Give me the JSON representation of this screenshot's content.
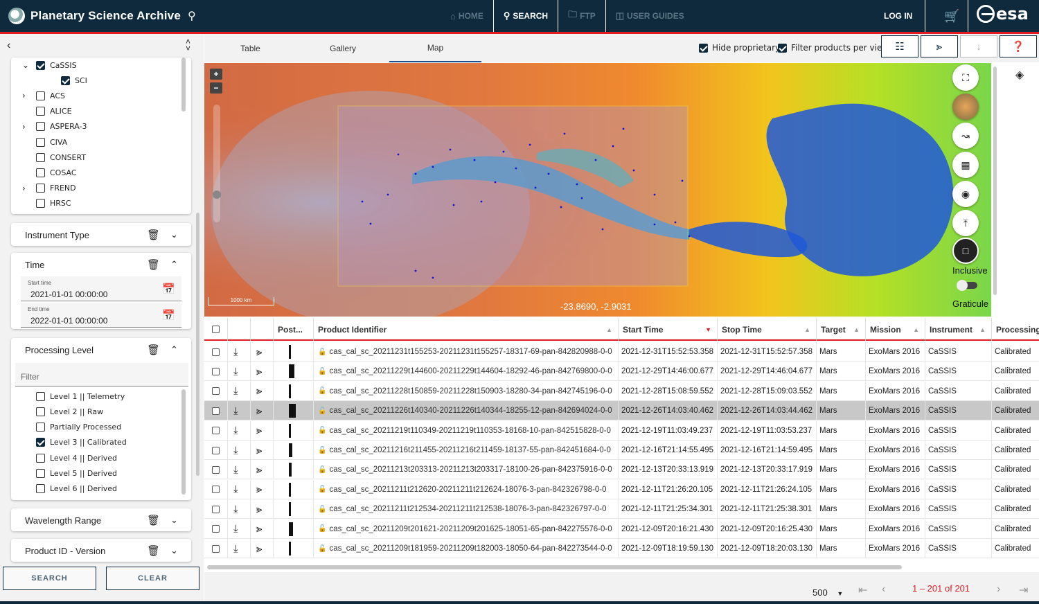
{
  "header": {
    "title": "Planetary Science Archive",
    "nav": [
      {
        "label": "HOME",
        "icon": "home-icon"
      },
      {
        "label": "SEARCH",
        "icon": "search-icon"
      },
      {
        "label": "FTP",
        "icon": "folder-icon"
      },
      {
        "label": "USER GUIDES",
        "icon": "book-icon"
      }
    ],
    "login": "LOG IN",
    "brand": "esa"
  },
  "sidebar": {
    "tree": [
      {
        "label": "CaSSIS",
        "checked": true,
        "expanded": true
      },
      {
        "label": "SCI",
        "checked": true,
        "child": true
      },
      {
        "label": "ACS",
        "checked": false,
        "expandable": true
      },
      {
        "label": "ALICE",
        "checked": false
      },
      {
        "label": "ASPERA-3",
        "checked": false,
        "expandable": true
      },
      {
        "label": "CIVA",
        "checked": false
      },
      {
        "label": "CONSERT",
        "checked": false
      },
      {
        "label": "COSAC",
        "checked": false
      },
      {
        "label": "FREND",
        "checked": false,
        "expandable": true
      },
      {
        "label": "HRSC",
        "checked": false
      }
    ],
    "instrument_type": "Instrument Type",
    "time": {
      "title": "Time",
      "start_label": "Start time",
      "start_value": "2021-01-01 00:00:00",
      "end_label": "End time",
      "end_value": "2022-01-01 00:00:00"
    },
    "processing": {
      "title": "Processing Level",
      "filter_placeholder": "Filter",
      "levels": [
        {
          "label": "Level 1 || Telemetry",
          "checked": false
        },
        {
          "label": "Level 2 || Raw",
          "checked": false
        },
        {
          "label": "Partially Processed",
          "checked": false
        },
        {
          "label": "Level 3 || Calibrated",
          "checked": true
        },
        {
          "label": "Level 4 || Derived",
          "checked": false
        },
        {
          "label": "Level 5 || Derived",
          "checked": false
        },
        {
          "label": "Level 6 || Derived",
          "checked": false
        }
      ]
    },
    "wavelength": "Wavelength Range",
    "product_id": "Product ID - Version",
    "search_button": "SEARCH",
    "clear_button": "CLEAR"
  },
  "tabs": [
    "Table",
    "Gallery",
    "Map"
  ],
  "options": {
    "hide_proprietary": "Hide proprietary",
    "filter_per_view": "Filter products per view"
  },
  "map": {
    "scale": "1000 km",
    "coords": "-23.8690, -2.9031",
    "inclusive_label": "Inclusive",
    "graticule_label": "Graticule"
  },
  "table": {
    "columns": [
      "Post...",
      "Product Identifier",
      "Start Time",
      "Stop Time",
      "Target",
      "Mission",
      "Instrument",
      "Processing"
    ],
    "rows": [
      {
        "id": "cas_cal_sc_20211231t155253-20211231t155257-18317-69-pan-842820988-0-0",
        "start": "2021-12-31T15:52:53.358",
        "stop": "2021-12-31T15:52:57.358",
        "target": "Mars",
        "mission": "ExoMars 2016",
        "instrument": "CaSSIS",
        "processing": "Calibrated"
      },
      {
        "id": "cas_cal_sc_20211229t144600-20211229t144604-18292-46-pan-842769800-0-0",
        "start": "2021-12-29T14:46:00.677",
        "stop": "2021-12-29T14:46:04.677",
        "target": "Mars",
        "mission": "ExoMars 2016",
        "instrument": "CaSSIS",
        "processing": "Calibrated"
      },
      {
        "id": "cas_cal_sc_20211228t150859-20211228t150903-18280-34-pan-842745196-0-0",
        "start": "2021-12-28T15:08:59.552",
        "stop": "2021-12-28T15:09:03.552",
        "target": "Mars",
        "mission": "ExoMars 2016",
        "instrument": "CaSSIS",
        "processing": "Calibrated"
      },
      {
        "id": "cas_cal_sc_20211226t140340-20211226t140344-18255-12-pan-842694024-0-0",
        "start": "2021-12-26T14:03:40.462",
        "stop": "2021-12-26T14:03:44.462",
        "target": "Mars",
        "mission": "ExoMars 2016",
        "instrument": "CaSSIS",
        "processing": "Calibrated"
      },
      {
        "id": "cas_cal_sc_20211219t110349-20211219t110353-18168-10-pan-842515828-0-0",
        "start": "2021-12-19T11:03:49.237",
        "stop": "2021-12-19T11:03:53.237",
        "target": "Mars",
        "mission": "ExoMars 2016",
        "instrument": "CaSSIS",
        "processing": "Calibrated"
      },
      {
        "id": "cas_cal_sc_20211216t211455-20211216t211459-18137-55-pan-842451684-0-0",
        "start": "2021-12-16T21:14:55.495",
        "stop": "2021-12-16T21:14:59.495",
        "target": "Mars",
        "mission": "ExoMars 2016",
        "instrument": "CaSSIS",
        "processing": "Calibrated"
      },
      {
        "id": "cas_cal_sc_20211213t203313-20211213t203317-18100-26-pan-842375916-0-0",
        "start": "2021-12-13T20:33:13.919",
        "stop": "2021-12-13T20:33:17.919",
        "target": "Mars",
        "mission": "ExoMars 2016",
        "instrument": "CaSSIS",
        "processing": "Calibrated"
      },
      {
        "id": "cas_cal_sc_20211211t212620-20211211t212624-18076-3-pan-842326798-0-0",
        "start": "2021-12-11T21:26:20.105",
        "stop": "2021-12-11T21:26:24.105",
        "target": "Mars",
        "mission": "ExoMars 2016",
        "instrument": "CaSSIS",
        "processing": "Calibrated"
      },
      {
        "id": "cas_cal_sc_20211211t212534-20211211t212538-18076-3-pan-842326797-0-0",
        "start": "2021-12-11T21:25:34.301",
        "stop": "2021-12-11T21:25:38.301",
        "target": "Mars",
        "mission": "ExoMars 2016",
        "instrument": "CaSSIS",
        "processing": "Calibrated"
      },
      {
        "id": "cas_cal_sc_20211209t201621-20211209t201625-18051-65-pan-842275576-0-0",
        "start": "2021-12-09T20:16:21.430",
        "stop": "2021-12-09T20:16:25.430",
        "target": "Mars",
        "mission": "ExoMars 2016",
        "instrument": "CaSSIS",
        "processing": "Calibrated"
      },
      {
        "id": "cas_cal_sc_20211209t181959-20211209t182003-18050-64-pan-842273544-0-0",
        "start": "2021-12-09T18:19:59.130",
        "stop": "2021-12-09T18:20:03.130",
        "target": "Mars",
        "mission": "ExoMars 2016",
        "instrument": "CaSSIS",
        "processing": "Calibrated"
      }
    ],
    "selected_row": 3
  },
  "footer": {
    "page_size": "500",
    "range": "1 – 201 of 201"
  }
}
